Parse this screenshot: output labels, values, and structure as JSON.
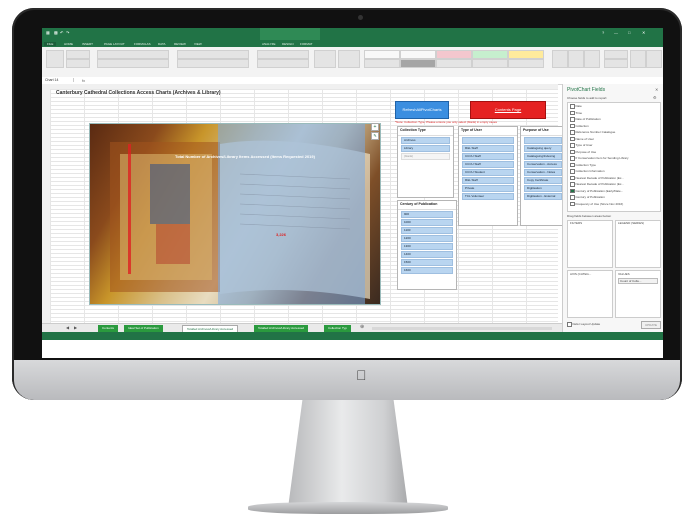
{
  "excel": {
    "ribbon_tabs": [
      "FILE",
      "HOME",
      "INSERT",
      "PAGE LAYOUT",
      "FORMULAS",
      "DATA",
      "REVIEW",
      "VIEW",
      "ANALYZE",
      "DESIGN",
      "FORMAT"
    ],
    "name_box": "Chart 14",
    "sheet_title": "Canterbury Cathedral Collections Access Charts (Archives & Library)",
    "chart_title": "Total Number of Archives/Library Items Accessed (Items Requested 2019)",
    "chart_value_label": "3,226",
    "buttons": {
      "refresh": "RefreshAllPivotCharts",
      "contents": "Contents Page"
    },
    "note": "*Note: Collection Type: Please ensure you only select (blank) in empty cases",
    "slicers": {
      "collection_type": {
        "title": "Collection Type",
        "items": [
          "Archives",
          "Library",
          "(blank)"
        ]
      },
      "type_of_user": {
        "title": "Type of User",
        "items": [
          "",
          "R&L Staff",
          "CCCU Staff",
          "CCCU Staff",
          "CCCU Student",
          "R&L Staff",
          "Private",
          "TCL Volunteer"
        ]
      },
      "purpose_of_use": {
        "title": "Purpose of Use",
        "items": [
          "",
          "Cataloguing query",
          "Cataloguing/Indexing",
          "Conservation - Access",
          "Conservation - Notes",
          "Copy Certificate",
          "Digitisation",
          "Digitisation - External"
        ]
      },
      "century": {
        "title": "Century of Publication",
        "items": [
          "900",
          "1000",
          "1100",
          "1200",
          "1300",
          "1400",
          "1500",
          "1600"
        ]
      }
    },
    "sheet_tabs": [
      "Contents",
      "Ideal Set of Publication",
      "Totalled Archives/Library Accessed",
      "Totalled Archives/Library Accessed",
      "Collection Typ"
    ],
    "active_tab_index": 2,
    "pivot_pane": {
      "title": "PivotChart Fields",
      "subtitle": "Choose fields to add to report:",
      "fields": [
        {
          "label": "Date",
          "checked": false
        },
        {
          "label": "Time",
          "checked": false
        },
        {
          "label": "Date of Publication",
          "checked": false
        },
        {
          "label": "Collection",
          "checked": false
        },
        {
          "label": "Reference Number Catalogue",
          "checked": false
        },
        {
          "label": "Name of User",
          "checked": false
        },
        {
          "label": "Type of User",
          "checked": false
        },
        {
          "label": "Purpose of Use",
          "checked": false
        },
        {
          "label": "If Conservation Item for Sending Library",
          "checked": false
        },
        {
          "label": "Collection Type",
          "checked": false
        },
        {
          "label": "Collection Information",
          "checked": false
        },
        {
          "label": "Nearest Decade of Publication (Ex...",
          "checked": false
        },
        {
          "label": "Nearest Decade of Publication (Ex...",
          "checked": false
        },
        {
          "label": "Century of Publication (Early/Date...",
          "checked": true
        },
        {
          "label": "Century of Publication",
          "checked": false
        },
        {
          "label": "Frequency of Use (Since Nov 2016)",
          "checked": false
        }
      ],
      "drag_label": "Drag fields between areas below:",
      "areas": {
        "filters": "FILTERS",
        "legend": "LEGEND (SERIES)",
        "axis": "AXIS (CATEG...",
        "values": "VALUES",
        "axis_item": "Century of Publ...",
        "values_item": "Count of Colle..."
      },
      "defer_label": "Defer Layout Update",
      "update_label": "UPDATE"
    }
  }
}
